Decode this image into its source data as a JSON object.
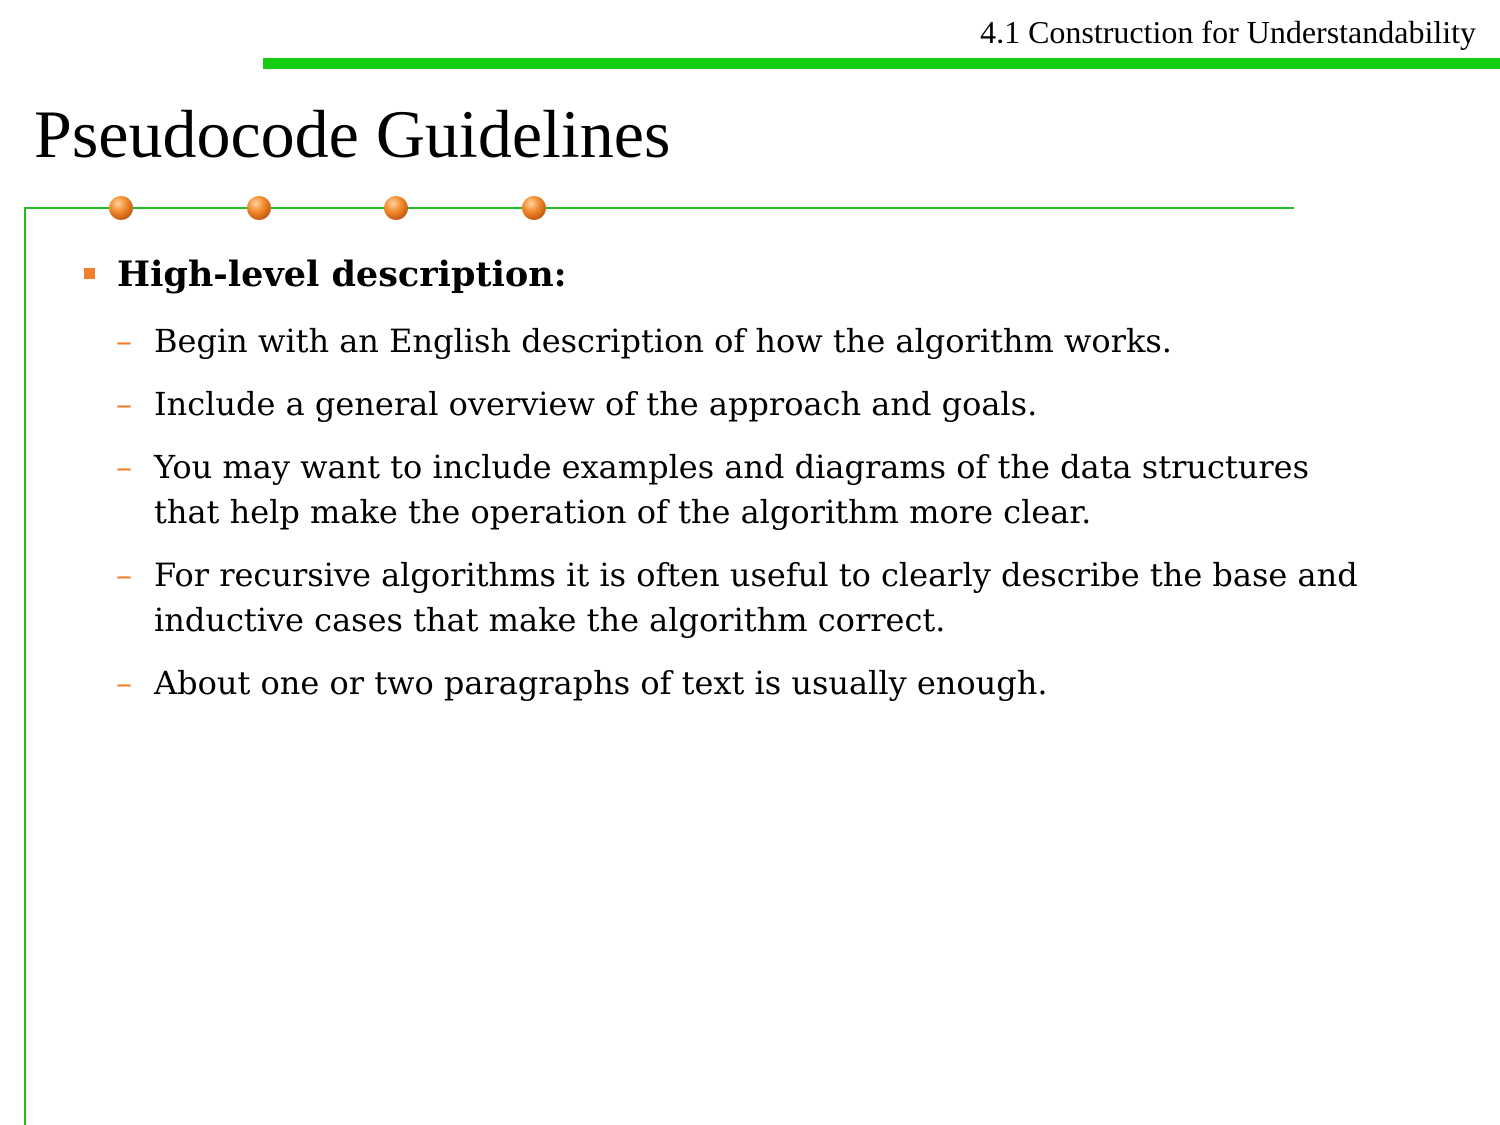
{
  "header": {
    "section_title": "4.1 Construction for Understandability"
  },
  "slide": {
    "title": "Pseudocode Guidelines",
    "main_bullet": "High-level description:",
    "sub_bullets": [
      "Begin with an English description of how the algorithm works.",
      "Include a general overview of the approach and goals.",
      "You may want to include examples and diagrams of the data structures that help make the operation of the algorithm more clear.",
      "For recursive algorithms it is often useful to clearly describe the base and inductive cases that make the algorithm correct.",
      "About one or two paragraphs of text is usually enough."
    ],
    "dash_glyph": "–",
    "colors": {
      "accent_green": "#11cc11",
      "bullet_orange": "#f27d2a"
    }
  }
}
